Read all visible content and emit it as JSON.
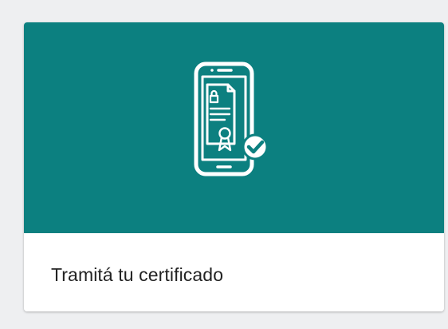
{
  "card": {
    "title": "Tramitá tu certificado",
    "icon": "mobile-certificate-check-icon"
  },
  "colors": {
    "page_background": "#eeeff1",
    "media_background": "#0c8080",
    "icon_stroke": "#ffffff",
    "title_text": "#222222"
  }
}
